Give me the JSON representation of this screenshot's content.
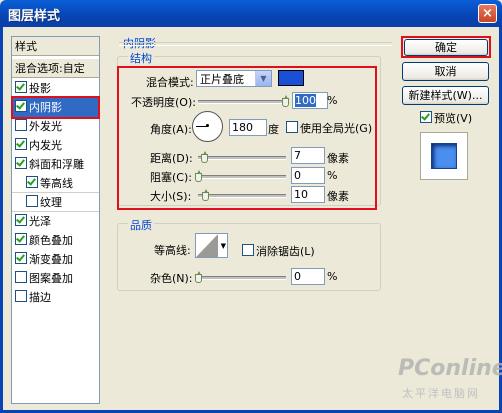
{
  "window": {
    "title": "图层样式",
    "close_glyph": "×"
  },
  "style_list": {
    "header": "样式",
    "blend_options": "混合选项:自定",
    "items": [
      {
        "label": "投影",
        "checked": true
      },
      {
        "label": "内阴影",
        "checked": true
      },
      {
        "label": "外发光",
        "checked": false
      },
      {
        "label": "内发光",
        "checked": true
      },
      {
        "label": "斜面和浮雕",
        "checked": true
      },
      {
        "label": "等高线",
        "checked": true
      },
      {
        "label": "纹理",
        "checked": false
      },
      {
        "label": "光泽",
        "checked": true
      },
      {
        "label": "颜色叠加",
        "checked": true
      },
      {
        "label": "渐变叠加",
        "checked": true
      },
      {
        "label": "图案叠加",
        "checked": false
      },
      {
        "label": "描边",
        "checked": false
      }
    ]
  },
  "inner_shadow": {
    "section_title": "内阴影",
    "structure": {
      "title": "结构",
      "blend_mode_label": "混合模式:",
      "blend_mode_value": "正片叠底",
      "color": "#1a4fd6",
      "opacity_label": "不透明度(O):",
      "opacity_value": "100",
      "opacity_unit": "%",
      "angle_label": "角度(A):",
      "angle_value": "180",
      "angle_unit": "度",
      "global_light_label": "使用全局光(G)",
      "distance_label": "距离(D):",
      "distance_value": "7",
      "distance_unit": "像素",
      "choke_label": "阻塞(C):",
      "choke_value": "0",
      "choke_unit": "%",
      "size_label": "大小(S):",
      "size_value": "10",
      "size_unit": "像素"
    },
    "quality": {
      "title": "品质",
      "contour_label": "等高线:",
      "anti_alias_label": "消除锯齿(L)",
      "noise_label": "杂色(N):",
      "noise_value": "0",
      "noise_unit": "%"
    }
  },
  "buttons": {
    "ok": "确定",
    "cancel": "取消",
    "new_style": "新建样式(W)...",
    "preview_label": "预览(V)"
  },
  "watermark": {
    "brand": "PConline",
    "sub": "太平洋电脑网"
  },
  "colors": {
    "accent_red": "#e0101a",
    "selection": "#316ac5",
    "title_bar": "#0844b4"
  }
}
